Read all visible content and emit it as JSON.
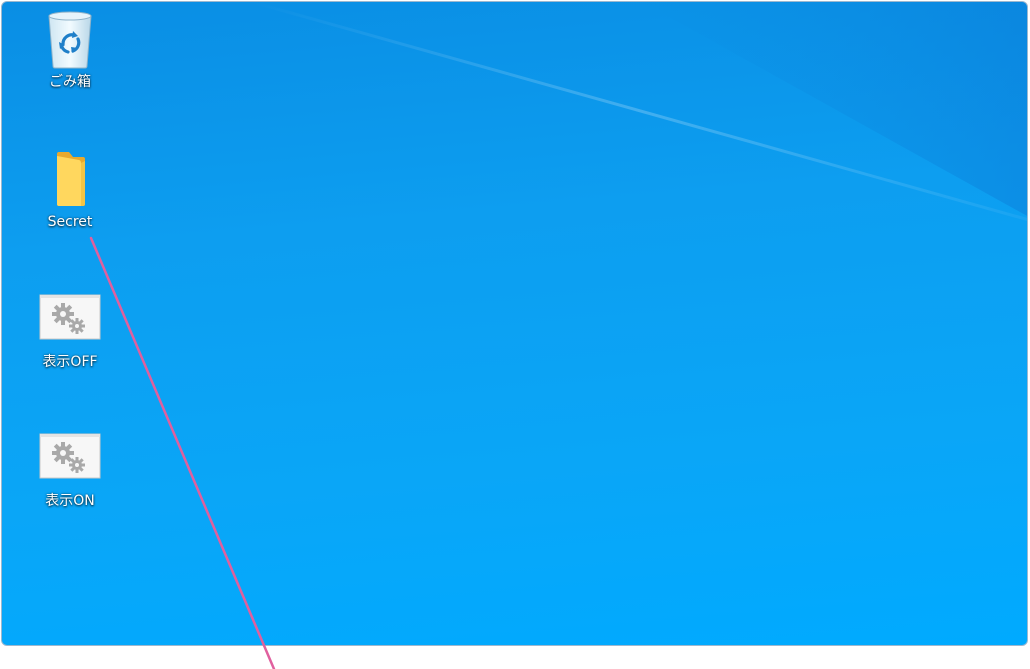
{
  "desktop": {
    "icons": [
      {
        "label": "ごみ箱",
        "icon": "recycle-bin-icon"
      },
      {
        "label": "Secret",
        "icon": "folder-icon"
      },
      {
        "label": "表示OFF",
        "icon": "settings-gears-icon"
      },
      {
        "label": "表示ON",
        "icon": "settings-gears-icon"
      }
    ]
  },
  "colors": {
    "wallpaper_top": "#0a8ee4",
    "wallpaper_bottom": "#00aaff",
    "annotation_line": "#e0609e",
    "folder": "#f7ce4e"
  }
}
